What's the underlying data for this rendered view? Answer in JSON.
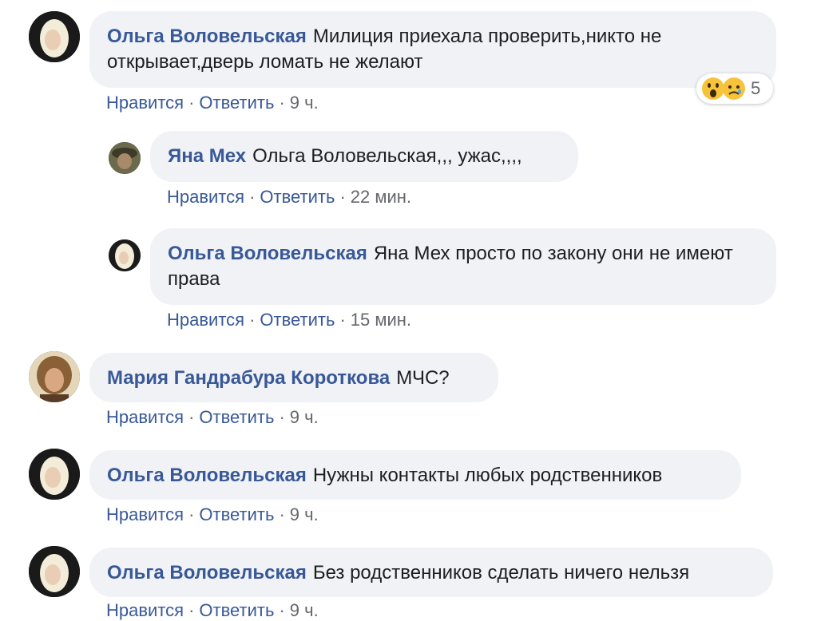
{
  "comments": [
    {
      "author": "Ольга Воловельская",
      "text": "Милиция приехала проверить,никто не открывает,дверь ломать не желают",
      "like": "Нравится",
      "reply": "Ответить",
      "time": "9 ч.",
      "reactions": {
        "icons": [
          "wow-emoji-icon",
          "sad-emoji-icon"
        ],
        "count": "5"
      }
    },
    {
      "author": "Яна Мех",
      "text": "Ольга Воловельская,,, ужас,,,,",
      "like": "Нравится",
      "reply": "Ответить",
      "time": "22 мин."
    },
    {
      "author": "Ольга Воловельская",
      "text": "Яна Мех просто по закону они не имеют права",
      "like": "Нравится",
      "reply": "Ответить",
      "time": "15 мин."
    },
    {
      "author": "Мария Гандрабура Короткова",
      "text": "МЧС?",
      "like": "Нравится",
      "reply": "Ответить",
      "time": "9 ч."
    },
    {
      "author": "Ольга Воловельская",
      "text": "Нужны контакты любых родственников",
      "like": "Нравится",
      "reply": "Ответить",
      "time": "9 ч."
    },
    {
      "author": "Ольга Воловельская",
      "text": "Без родственников сделать ничего нельзя",
      "like": "Нравится",
      "reply": "Ответить",
      "time": "9 ч."
    }
  ],
  "colors": {
    "author_link": "#385898",
    "bubble_bg": "#f0f2f5",
    "meta_text": "#65676b"
  }
}
